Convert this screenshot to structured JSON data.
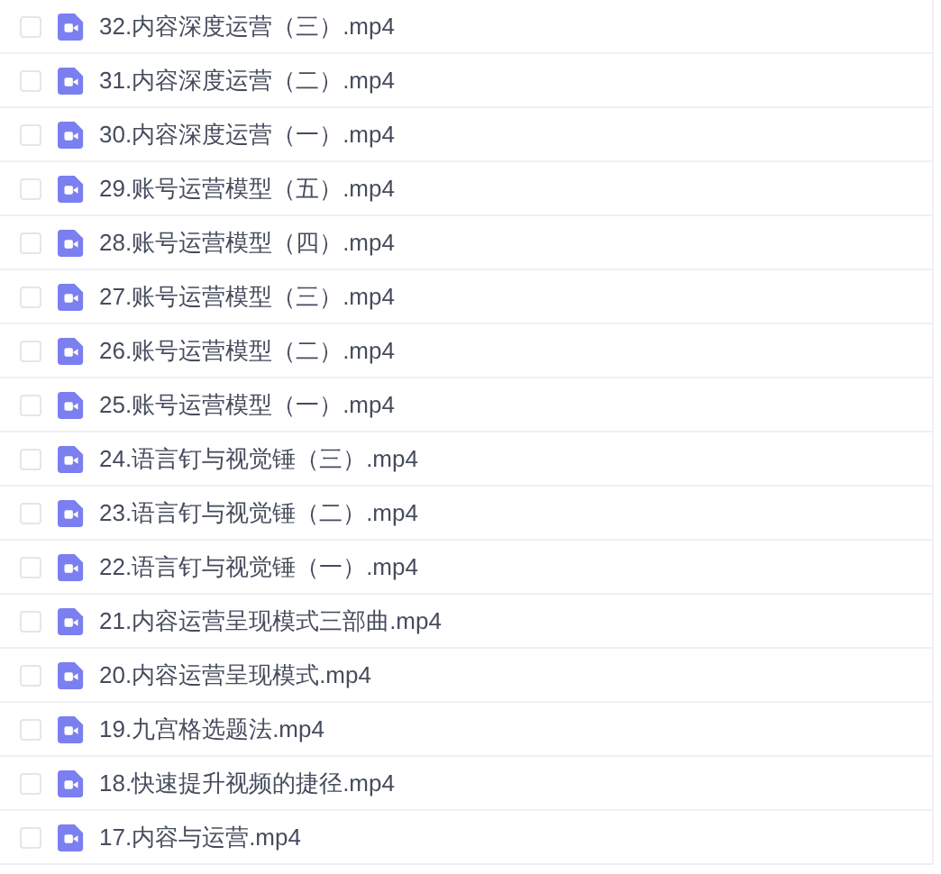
{
  "files": [
    {
      "name": "32.内容深度运营（三）.mp4",
      "checked": false
    },
    {
      "name": "31.内容深度运营（二）.mp4",
      "checked": false
    },
    {
      "name": "30.内容深度运营（一）.mp4",
      "checked": false
    },
    {
      "name": "29.账号运营模型（五）.mp4",
      "checked": false
    },
    {
      "name": "28.账号运营模型（四）.mp4",
      "checked": false
    },
    {
      "name": "27.账号运营模型（三）.mp4",
      "checked": false
    },
    {
      "name": "26.账号运营模型（二）.mp4",
      "checked": false
    },
    {
      "name": "25.账号运营模型（一）.mp4",
      "checked": false
    },
    {
      "name": "24.语言钉与视觉锤（三）.mp4",
      "checked": false
    },
    {
      "name": "23.语言钉与视觉锤（二）.mp4",
      "checked": false
    },
    {
      "name": "22.语言钉与视觉锤（一）.mp4",
      "checked": false
    },
    {
      "name": "21.内容运营呈现模式三部曲.mp4",
      "checked": false
    },
    {
      "name": "20.内容运营呈现模式.mp4",
      "checked": false
    },
    {
      "name": "19.九宫格选题法.mp4",
      "checked": false
    },
    {
      "name": "18.快速提升视频的捷径.mp4",
      "checked": false
    },
    {
      "name": "17.内容与运营.mp4",
      "checked": false
    }
  ]
}
